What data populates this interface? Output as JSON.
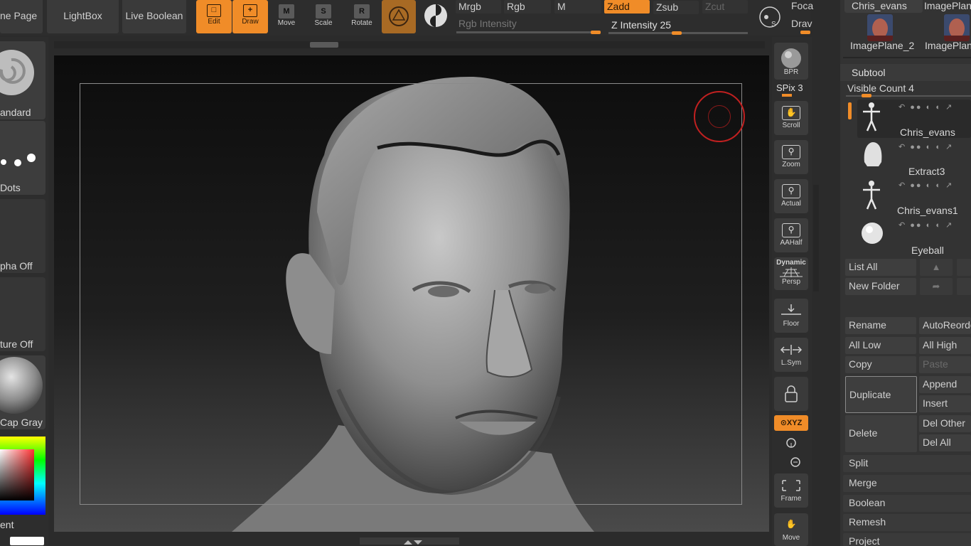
{
  "topbar": {
    "home_page": "ne Page",
    "lightbox": "LightBox",
    "live_boolean": "Live Boolean",
    "edit": "Edit",
    "draw": "Draw",
    "move": "Move",
    "scale": "Scale",
    "rotate": "Rotate",
    "move_key": "M",
    "scale_key": "S",
    "rotate_key": "R",
    "mrgb": "Mrgb",
    "rgb": "Rgb",
    "m": "M",
    "zadd": "Zadd",
    "zsub": "Zsub",
    "zcut": "Zcut",
    "rgb_intensity": "Rgb Intensity",
    "z_intensity": "Z Intensity 25",
    "z_intensity_value": 25,
    "focal": "Foca",
    "draw_size": "Drav",
    "focal_icon_key": "S"
  },
  "left_shelf": {
    "standard": "andard",
    "dots": "Dots",
    "alpha_off": "pha Off",
    "texture_off": "ture Off",
    "material": "Cap Gray",
    "gradient": "ent"
  },
  "right_shelf": {
    "bpr": "BPR",
    "spix": "SPix 3",
    "scroll": "Scroll",
    "zoom": "Zoom",
    "actual": "Actual",
    "aahalf": "AAHalf",
    "dynamic": "Dynamic",
    "persp": "Persp",
    "floor": "Floor",
    "lsym": "L.Sym",
    "xyz": "⊙XYZ",
    "frame": "Frame",
    "move": "Move"
  },
  "panel": {
    "top_items": [
      "Chris_evans",
      "ImagePlan",
      "ImagePlane_2",
      "ImagePlan"
    ],
    "subtool_title": "Subtool",
    "visible_count": "Visible Count 4",
    "subtools": [
      "Chris_evans",
      "Extract3",
      "Chris_evans1",
      "Eyeball"
    ],
    "list_all": "List All",
    "new_folder": "New Folder",
    "rename": "Rename",
    "auto_reorder": "AutoReorde",
    "all_low": "All Low",
    "all_high": "All High",
    "copy": "Copy",
    "paste": "Paste",
    "duplicate": "Duplicate",
    "append": "Append",
    "insert": "Insert",
    "delete": "Delete",
    "del_other": "Del Other",
    "del_all": "Del All",
    "split": "Split",
    "merge": "Merge",
    "boolean": "Boolean",
    "remesh": "Remesh",
    "project": "Project"
  },
  "colors": {
    "accent": "#f08c28",
    "background": "#2b2b2b",
    "button": "#3a3a3a"
  }
}
